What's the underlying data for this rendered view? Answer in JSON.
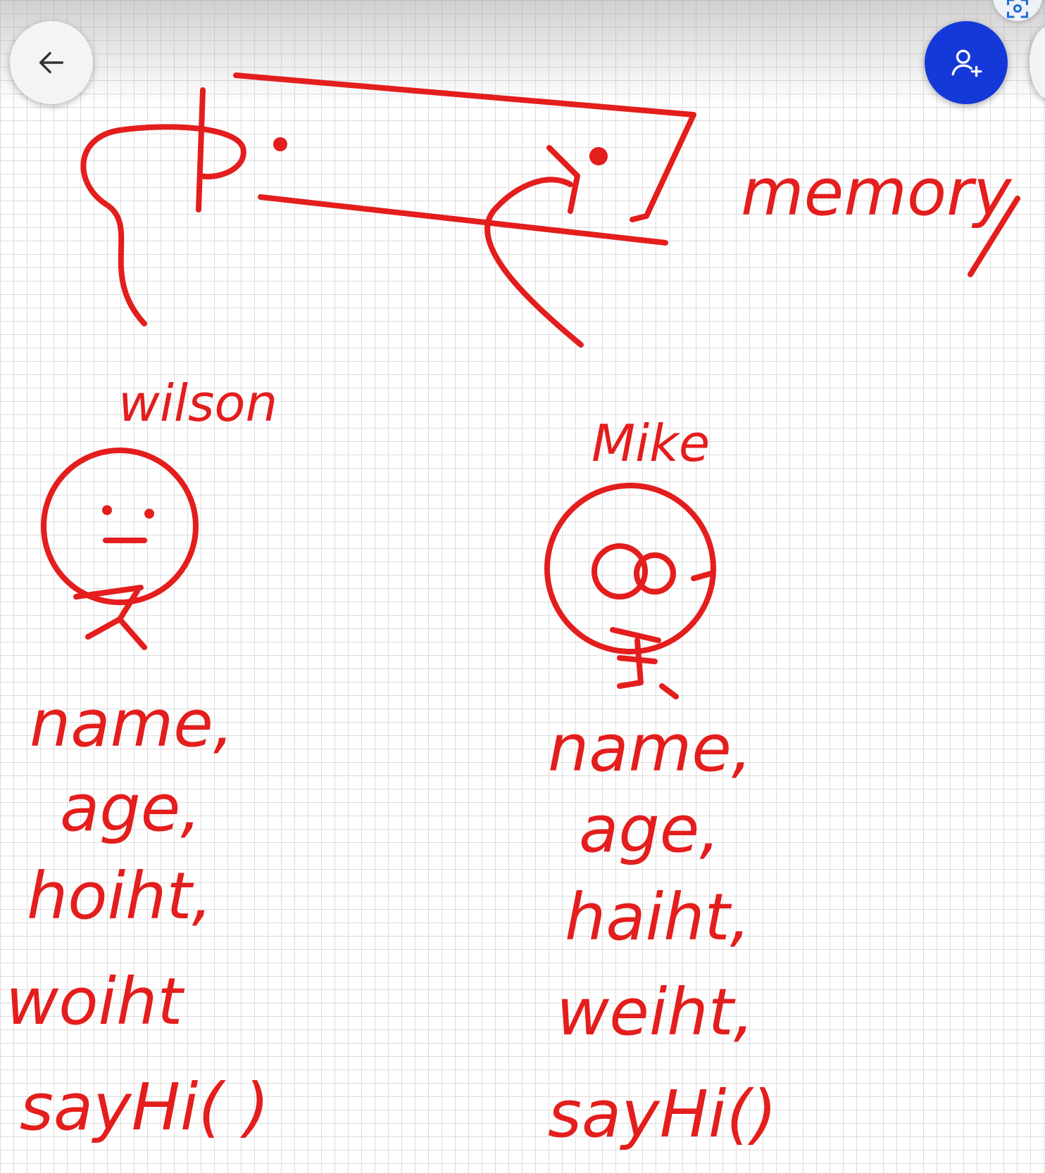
{
  "toolbar": {
    "back_icon": "arrow-left-icon",
    "add_user_icon": "person-add-icon",
    "scan_icon": "scan-icon",
    "accent_color": "#1539d8"
  },
  "canvas": {
    "ink_color": "#e41d1d",
    "memory_label": "memory",
    "left_person": {
      "name_label": "wilson",
      "properties": [
        "name,",
        "age,",
        "hoiht,",
        "woiht",
        "sayHi( )"
      ]
    },
    "right_person": {
      "name_label": "Mike",
      "properties": [
        "name,",
        "age,",
        "haiht,",
        "weiht,",
        "sayHi()"
      ]
    }
  }
}
